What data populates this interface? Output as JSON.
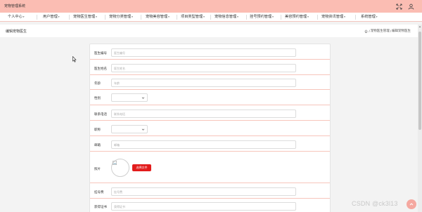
{
  "app": {
    "title": "宠物管理系统"
  },
  "nav": {
    "items": [
      {
        "label": "个人中心",
        "caret": "▾"
      },
      {
        "label": "用户管理",
        "caret": "▾"
      },
      {
        "label": "宠物医生管理",
        "caret": "▾"
      },
      {
        "label": "宠物分类管理",
        "caret": "▾"
      },
      {
        "label": "宠物美容管理",
        "caret": "▾"
      },
      {
        "label": "项目类型管理",
        "caret": "▾"
      },
      {
        "label": "宠物信息管理",
        "caret": "▾"
      },
      {
        "label": "挂号预约管理",
        "caret": "▾"
      },
      {
        "label": "美容预约管理",
        "caret": "▾"
      },
      {
        "label": "宠物资讯管理",
        "caret": "▾"
      },
      {
        "label": "系统管理",
        "caret": "▾"
      }
    ]
  },
  "page": {
    "title": "编辑宠物医生",
    "breadcrumb": [
      "宠物医生管理",
      "/",
      "编辑宠物医生"
    ],
    "breadcrumb_sep": "/"
  },
  "form": {
    "doctor_id": {
      "label": "医生编号",
      "placeholder": "医生编号"
    },
    "doctor_name": {
      "label": "医生姓名",
      "placeholder": "医生姓名"
    },
    "age": {
      "label": "年龄",
      "placeholder": "年龄"
    },
    "gender": {
      "label": "性别",
      "value": ""
    },
    "phone": {
      "label": "联系电话",
      "placeholder": "联系电话"
    },
    "position": {
      "label": "职称",
      "value": ""
    },
    "email": {
      "label": "邮箱",
      "placeholder": "邮箱"
    },
    "photo": {
      "label": "照片",
      "button": "选择文件"
    },
    "fee": {
      "label": "挂号费",
      "placeholder": "挂号费"
    },
    "certificate": {
      "label": "获得证书",
      "placeholder": "获得证书"
    }
  },
  "watermark": {
    "text": "CSDN @ck3l13"
  },
  "colors": {
    "accent": "#fbbdb3",
    "divider": "#f7c5bb",
    "button": "#e21c1c"
  }
}
